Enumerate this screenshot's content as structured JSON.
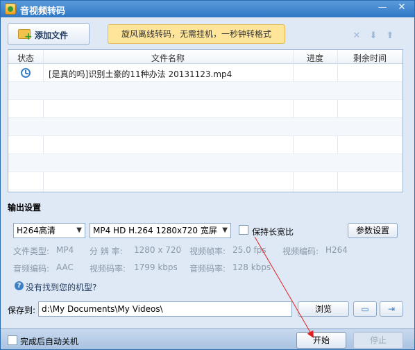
{
  "window": {
    "title": "音视频转码",
    "min_glyph": "—",
    "close_glyph": "✕"
  },
  "toolbar": {
    "add_file_label": "添加文件",
    "promo_text": "旋风离线转码，无需挂机，一秒钟转格式",
    "remove_glyph": "✕",
    "down_glyph": "⬇",
    "up_glyph": "⬆"
  },
  "file_table": {
    "headers": {
      "status": "状态",
      "name": "文件名称",
      "progress": "进度",
      "remaining": "剩余时间"
    },
    "rows": [
      {
        "status_icon": "clock-icon",
        "name": "[是真的吗]识别土豪的11种办法 20131123.mp4",
        "progress": "",
        "remaining": ""
      }
    ]
  },
  "output": {
    "section_title": "输出设置",
    "device_select": "H264高清",
    "format_select": "MP4 HD H.264 1280x720 宽屏",
    "keep_ratio_label": "保持长宽比",
    "keep_ratio_checked": false,
    "params_button": "参数设置",
    "specs": {
      "file_type_label": "文件类型:",
      "file_type_value": "MP4",
      "resolution_label": "分 辨 率:",
      "resolution_value": "1280 x 720",
      "fps_label": "视频帧率:",
      "fps_value": "25.0 fps",
      "video_codec_label": "视频编码:",
      "video_codec_value": "H264",
      "audio_codec_label": "音频编码:",
      "audio_codec_value": "AAC",
      "video_bitrate_label": "视频码率:",
      "video_bitrate_value": "1799 kbps",
      "audio_bitrate_label": "音频码率:",
      "audio_bitrate_value": "128 kbps"
    },
    "help_text": "没有找到您的机型?",
    "save_to_label": "保存到:",
    "save_path": "d:\\My Documents\\My Videos\\",
    "browse_button": "浏览"
  },
  "footer": {
    "shutdown_label": "完成后自动关机",
    "shutdown_checked": false,
    "start_button": "开始",
    "stop_button": "停止"
  },
  "colors": {
    "title_bar": "#2f77c4",
    "promo_bg": "#ffe59a",
    "annotation_arrow": "#e02020"
  }
}
